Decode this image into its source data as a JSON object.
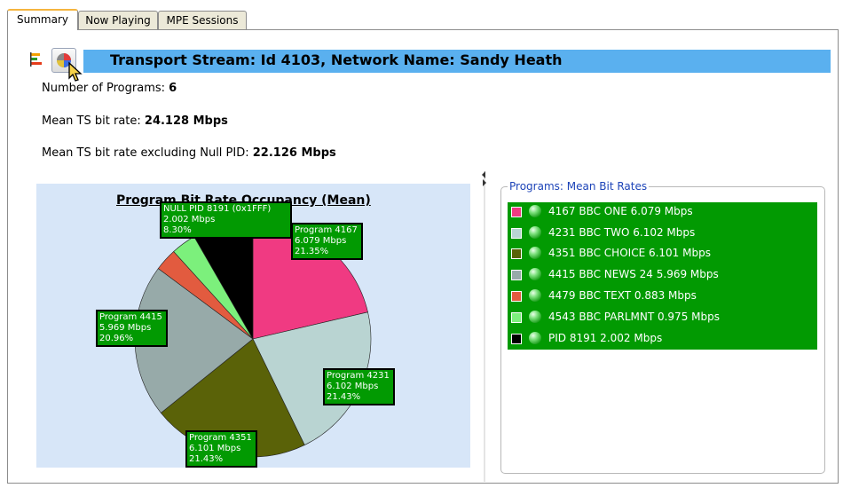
{
  "tabs": [
    {
      "label": "Summary",
      "active": true
    },
    {
      "label": "Now Playing",
      "active": false
    },
    {
      "label": "MPE Sessions",
      "active": false
    }
  ],
  "header": {
    "title": "Transport Stream: Id 4103, Network Name: Sandy Heath",
    "bar_color": "#5ab0ef"
  },
  "stats": {
    "programs_label": "Number of Programs:",
    "programs_value": "6",
    "mean_rate_label": "Mean TS bit rate:",
    "mean_rate_value": "24.128 Mbps",
    "mean_rate_nonull_label": "Mean TS bit rate excluding Null PID:",
    "mean_rate_nonull_value": "22.126 Mbps"
  },
  "chart_data": {
    "type": "pie",
    "title": "Program Bit Rate Occupancy (Mean)",
    "slices": [
      {
        "label": "Program 4167",
        "rate": "6.079 Mbps",
        "percent_label": "21.35%",
        "value": 21.35,
        "color": "#f03a82"
      },
      {
        "label": "Program 4231",
        "rate": "6.102 Mbps",
        "percent_label": "21.43%",
        "value": 21.43,
        "color": "#b9d4d2"
      },
      {
        "label": "Program 4351",
        "rate": "6.101 Mbps",
        "percent_label": "21.43%",
        "value": 21.43,
        "color": "#5a6208"
      },
      {
        "label": "Program 4415",
        "rate": "5.969 Mbps",
        "percent_label": "20.96%",
        "value": 20.96,
        "color": "#97aaa9"
      },
      {
        "label": "4479",
        "rate": "0.883 Mbps",
        "value": 3.1,
        "color": "#e25b3f"
      },
      {
        "label": "4543",
        "rate": "0.975 Mbps",
        "value": 3.42,
        "color": "#7cf07c"
      },
      {
        "label": "NULL PID 8191 (0x1FFF)",
        "rate": "2.002 Mbps",
        "percent_label": "8.30%",
        "value": 8.3,
        "color": "#000000"
      }
    ]
  },
  "legend": {
    "title": "Programs: Mean Bit Rates",
    "items": [
      {
        "text": "4167 BBC ONE    6.079 Mbps",
        "color": "#f03a82"
      },
      {
        "text": "4231 BBC TWO    6.102 Mbps",
        "color": "#b9d4d2"
      },
      {
        "text": "4351 BBC CHOICE    6.101 Mbps",
        "color": "#5a6208"
      },
      {
        "text": "4415 BBC NEWS 24    5.969 Mbps",
        "color": "#97aaa9"
      },
      {
        "text": "4479 BBC TEXT    0.883 Mbps",
        "color": "#e25b3f"
      },
      {
        "text": "4543 BBC PARLMNT    0.975 Mbps",
        "color": "#7cf07c"
      },
      {
        "text": "PID 8191 2.002 Mbps",
        "color": "#000000"
      }
    ]
  },
  "icons": [
    "bar-chart-icon",
    "pie-chart-icon",
    "cursor-pointer-icon"
  ]
}
